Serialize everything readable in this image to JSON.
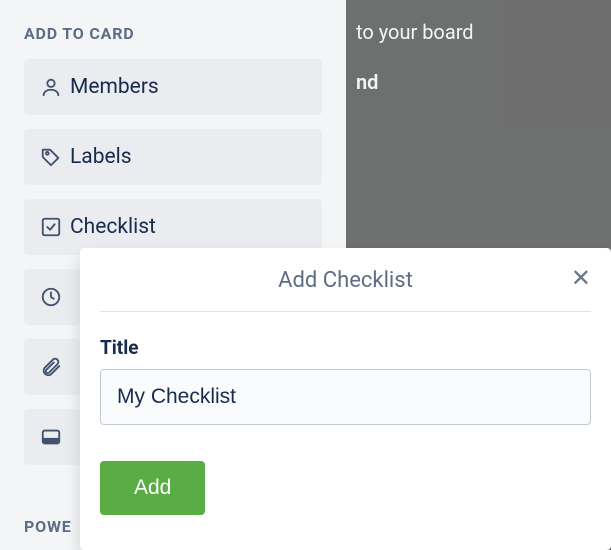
{
  "backdrop": {
    "line1": " to your board",
    "line2": "nd"
  },
  "sidebar": {
    "section_title": "ADD TO CARD",
    "items": [
      {
        "label": "Members"
      },
      {
        "label": "Labels"
      },
      {
        "label": "Checklist"
      },
      {
        "label": ""
      },
      {
        "label": ""
      },
      {
        "label": ""
      }
    ],
    "section_title_2": "POWE"
  },
  "popover": {
    "title": "Add Checklist",
    "close_glyph": "✕",
    "title_field_label": "Title",
    "title_value": "My Checklist",
    "add_button_label": "Add"
  }
}
